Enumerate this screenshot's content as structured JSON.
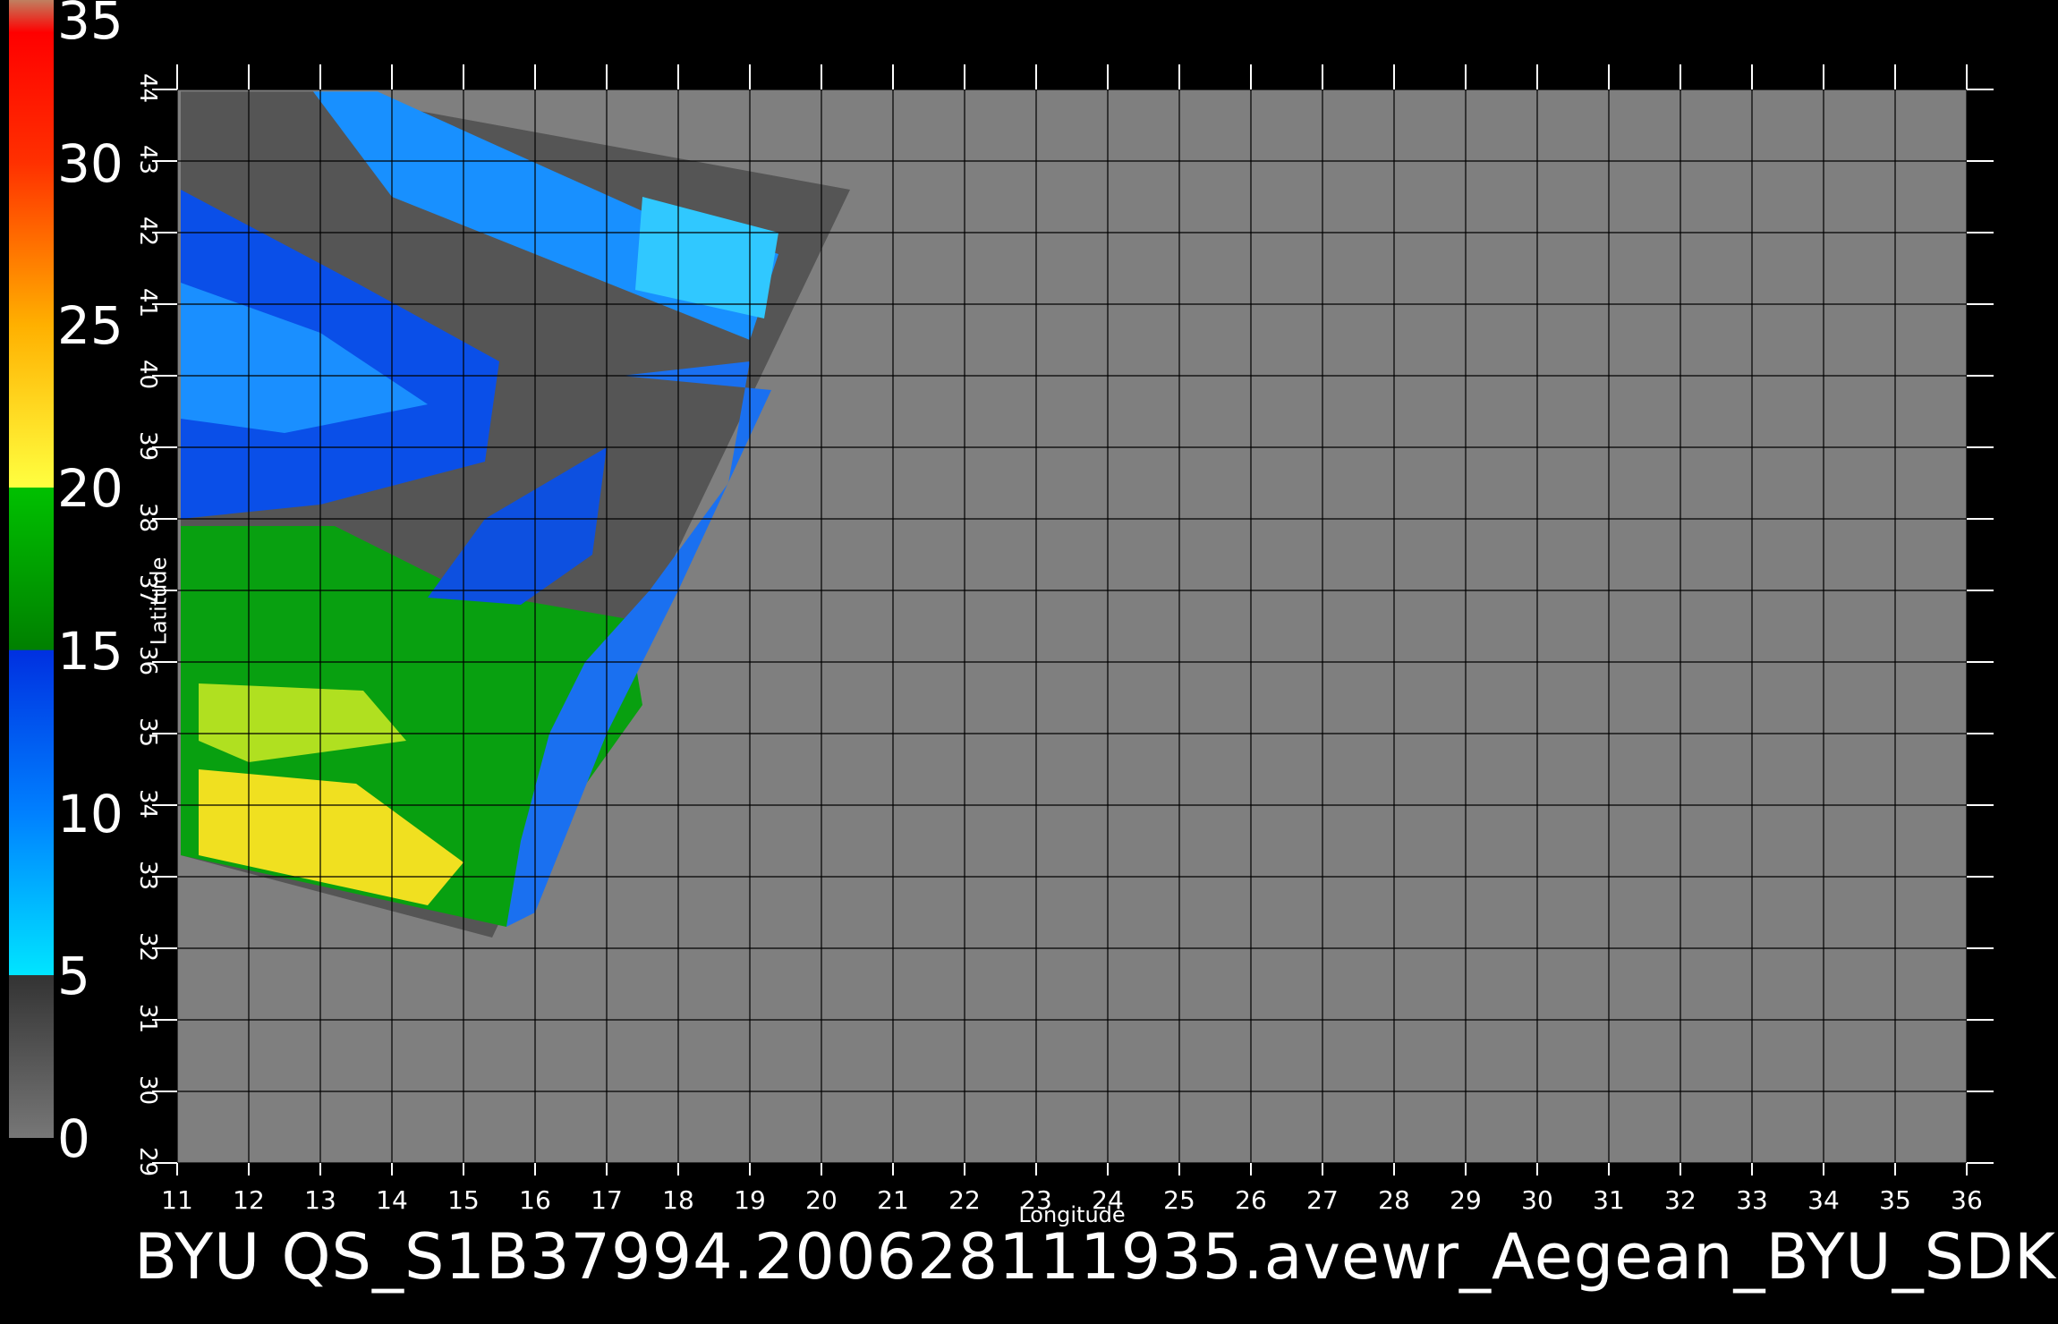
{
  "colorbar": {
    "labels": [
      "35",
      "30",
      "25",
      "20",
      "15",
      "10",
      "5",
      "0"
    ],
    "stops": [
      {
        "v": 0,
        "color": "#777777"
      },
      {
        "v": 5,
        "color": "#333333"
      },
      {
        "v": 5.01,
        "color": "#00e5ff"
      },
      {
        "v": 10,
        "color": "#0080ff"
      },
      {
        "v": 15,
        "color": "#0030e0"
      },
      {
        "v": 15.01,
        "color": "#008000"
      },
      {
        "v": 20,
        "color": "#00c000"
      },
      {
        "v": 20.01,
        "color": "#ffff40"
      },
      {
        "v": 25,
        "color": "#ffb000"
      },
      {
        "v": 30,
        "color": "#ff3000"
      },
      {
        "v": 34,
        "color": "#ff0000"
      },
      {
        "v": 35,
        "color": "#c08060"
      }
    ],
    "range": [
      0,
      35
    ]
  },
  "map": {
    "longitude_ticks": [
      "11",
      "12",
      "13",
      "14",
      "15",
      "16",
      "17",
      "18",
      "19",
      "20",
      "21",
      "22",
      "23",
      "24",
      "25",
      "26",
      "27",
      "28",
      "29",
      "30",
      "31",
      "32",
      "33",
      "34",
      "35",
      "36"
    ],
    "latitude_ticks": [
      "29",
      "30",
      "31",
      "32",
      "33",
      "34",
      "35",
      "36",
      "37",
      "38",
      "39",
      "40",
      "41",
      "42",
      "43",
      "44"
    ],
    "lon_range": [
      11,
      36
    ],
    "lat_range": [
      29,
      44
    ],
    "xlabel": "Longitude",
    "ylabel": "Latitude",
    "background_color": "#7f7f7f",
    "swath_color": "#555555",
    "land_color": "#555555"
  },
  "caption": "BYU QS_S1B37994.200628111935.avewr_Aegean_BYU_SDK"
}
